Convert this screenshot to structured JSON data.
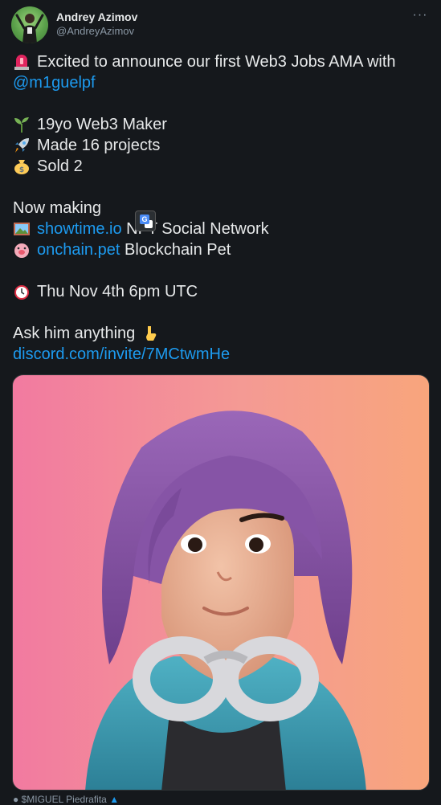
{
  "author": {
    "display_name": "Andrey Azimov",
    "handle": "@AndreyAzimov",
    "avatar_icon": "avatar-photo-icon"
  },
  "menu": {
    "more_label": "···"
  },
  "tweet": {
    "line1": {
      "emoji": "rotating-light-icon",
      "text": "Excited to announce our first Web3 Jobs AMA with"
    },
    "mention": "@m1guelpf",
    "line_maker": {
      "emoji": "seedling-icon",
      "text": "19yo Web3 Maker"
    },
    "line_projects": {
      "emoji": "rocket-icon",
      "text": "Made 16 projects"
    },
    "line_sold": {
      "emoji": "money-bag-icon",
      "text": "Sold 2"
    },
    "now_making": "Now making",
    "showtime": {
      "emoji": "framed-picture-icon",
      "link": "showtime.io",
      "text": "NFT Social Network"
    },
    "onchain": {
      "emoji": "pig-face-icon",
      "link": "onchain.pet",
      "text": "Blockchain Pet"
    },
    "date": {
      "emoji": "alarm-clock-icon",
      "text": "Thu Nov 4th 6pm UTC"
    },
    "ask": {
      "text": "Ask him anything",
      "emoji": "pointing-down-icon"
    },
    "discord_link": "discord.com/invite/7MCtwmHe"
  },
  "media": {
    "alt_icon": "3d-avatar-image"
  },
  "footer": {
    "text": "$MIGUEL Piedrafita"
  },
  "colors": {
    "background": "#15181c",
    "text": "#e7e9ea",
    "link": "#1d9bf0",
    "muted": "#8b98a5"
  }
}
